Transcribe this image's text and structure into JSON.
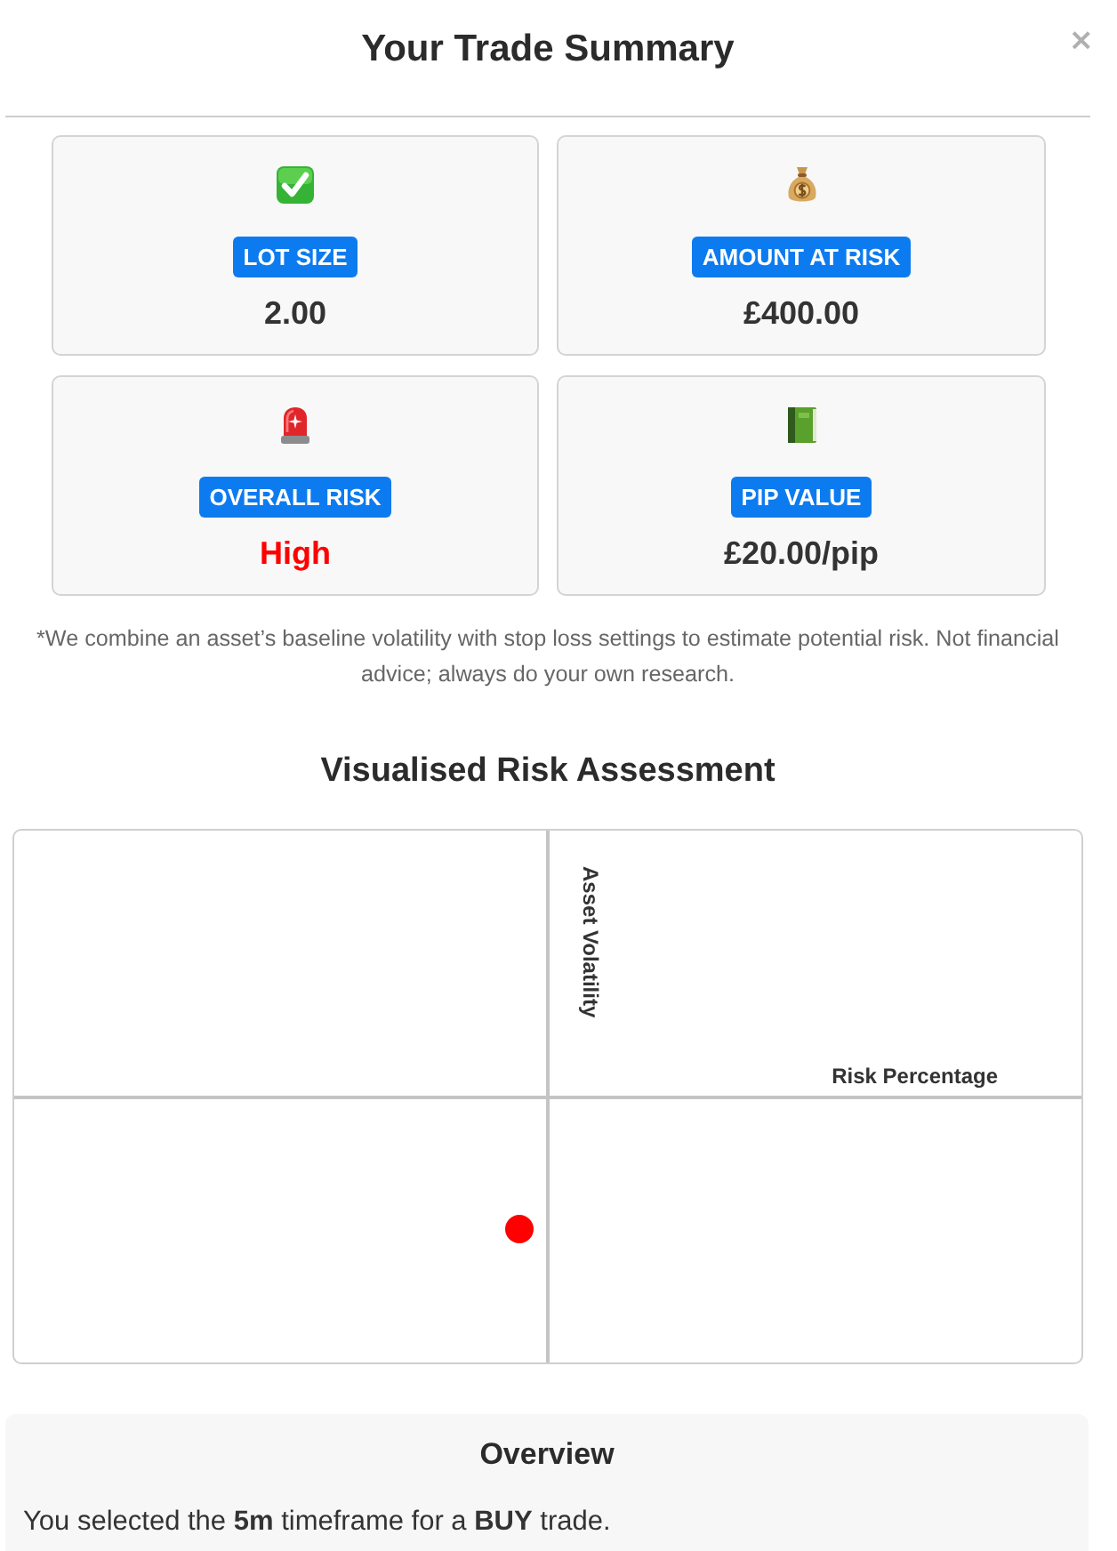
{
  "modal": {
    "title": "Your Trade Summary",
    "close_label": "×"
  },
  "cards": [
    {
      "label": "LOT SIZE",
      "value": "2.00",
      "color": "#333333"
    },
    {
      "label": "AMOUNT AT RISK",
      "value": "£400.00",
      "color": "#333333"
    },
    {
      "label": "OVERALL RISK",
      "value": "High",
      "color": "#ff0000"
    },
    {
      "label": "PIP VALUE",
      "value": "£20.00/pip",
      "color": "#333333"
    }
  ],
  "footnote": "*We combine an asset’s baseline volatility with stop loss settings to estimate potential risk. Not financial advice; always do your own research.",
  "risk_chart": {
    "title": "Visualised Risk Assessment",
    "ylabel": "Asset Volatility",
    "xlabel": "Risk Percentage"
  },
  "overview": {
    "title": "Overview",
    "text": "You selected the **5m** timeframe for a **BUY** trade."
  }
}
